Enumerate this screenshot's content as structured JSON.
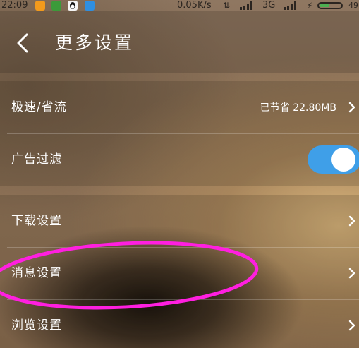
{
  "status_bar": {
    "time": "22:09",
    "network_speed": "0.05K/s",
    "network_type": "3G",
    "battery_level": "49",
    "app_icons": [
      "uc-browser-icon",
      "green-app-icon",
      "qq-penguin-icon",
      "blue-lock-app-icon"
    ]
  },
  "header": {
    "back_icon": "chevron-left-icon",
    "title": "更多设置"
  },
  "settings": {
    "speed_saving": {
      "label": "极速/省流",
      "value": "已节省 22.80MB"
    },
    "ad_filter": {
      "label": "广告过滤",
      "enabled": true
    },
    "download": {
      "label": "下载设置"
    },
    "message": {
      "label": "消息设置"
    },
    "browse": {
      "label": "浏览设置"
    }
  },
  "colors": {
    "toggle_on": "#3f9fe8",
    "annotation": "#ff1fe0",
    "text": "#ffffff"
  }
}
